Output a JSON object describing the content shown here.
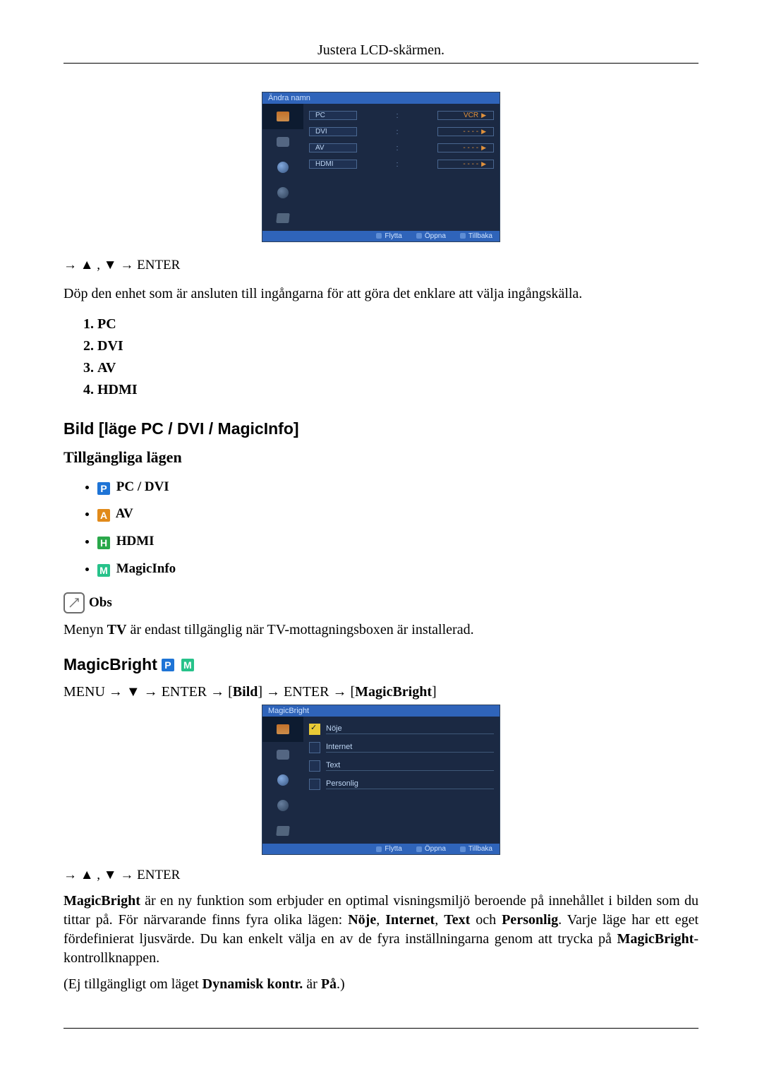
{
  "header_title": "Justera LCD-skärmen.",
  "osd1": {
    "title": "Ändra namn",
    "rows": [
      {
        "label": "PC",
        "value": "VCR"
      },
      {
        "label": "DVI",
        "value": "- - - -"
      },
      {
        "label": "AV",
        "value": "- - - -"
      },
      {
        "label": "HDMI",
        "value": "- - - -"
      }
    ],
    "footer": {
      "move": "Flytta",
      "open": "Öppna",
      "back": "Tillbaka"
    }
  },
  "nav_line": "→ ▲ , ▼ → ENTER",
  "desc_rename": "Döp den enhet som är ansluten till ingångarna för att göra det enklare att välja ingångskälla.",
  "inputs": [
    "PC",
    "DVI",
    "AV",
    "HDMI"
  ],
  "section_bild_heading": "Bild [läge PC / DVI / MagicInfo]",
  "modes_heading": "Tillgängliga lägen",
  "modes": [
    {
      "badge": "P",
      "label": "PC / DVI"
    },
    {
      "badge": "A",
      "label": "AV"
    },
    {
      "badge": "H",
      "label": "HDMI"
    },
    {
      "badge": "M",
      "label": "MagicInfo"
    }
  ],
  "obs_label": "Obs",
  "obs_text_1": "Menyn ",
  "obs_bold": "TV",
  "obs_text_2": " är endast tillgänglig när TV-mottagningsboxen är installerad.",
  "magicbright_heading": "MagicBright",
  "mb_nav_parts": {
    "menu": "MENU",
    "enter1": "ENTER",
    "bild": "Bild",
    "enter2": "ENTER",
    "mb": "MagicBright"
  },
  "osd2": {
    "title": "MagicBright",
    "options": [
      "Nöje",
      "Internet",
      "Text",
      "Personlig"
    ],
    "footer": {
      "move": "Flytta",
      "open": "Öppna",
      "back": "Tillbaka"
    }
  },
  "nav_line2": "→ ▲ , ▼ → ENTER",
  "mb_para_parts": {
    "b1": "MagicBright",
    "t1": " är en ny funktion som erbjuder en optimal visningsmiljö beroende på innehållet i bilden som du tittar på. För närvarande finns fyra olika lägen: ",
    "b2": "Nöje",
    "b3": "Internet",
    "b4": "Text",
    "och": " och ",
    "b5": "Personlig",
    "t2": ". Varje läge har ett eget fördefinierat ljusvärde. Du kan enkelt välja en av de fyra inställningarna genom att trycka på ",
    "b6": "MagicBright",
    "t3": "-kontrollknappen."
  },
  "mb_note_parts": {
    "t1": "(Ej tillgängligt om läget ",
    "b1": "Dynamisk kontr.",
    "t2": " är ",
    "b2": "På",
    "t3": ".)"
  }
}
